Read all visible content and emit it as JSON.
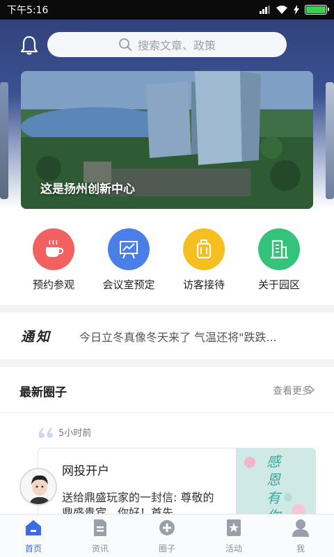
{
  "status": {
    "time": "下午5:16"
  },
  "search": {
    "placeholder": "搜索文章、政策"
  },
  "banner": {
    "caption": "这是扬州创新中心"
  },
  "quick_actions": [
    {
      "label": "预约参观",
      "icon": "coffee-cup-icon",
      "color": "#f2605f"
    },
    {
      "label": "会议室预定",
      "icon": "presentation-board-icon",
      "color": "#4a7ee8"
    },
    {
      "label": "访客接待",
      "icon": "luggage-icon",
      "color": "#f6bf1f"
    },
    {
      "label": "关于园区",
      "icon": "building-icon",
      "color": "#33c37a"
    }
  ],
  "notice": {
    "title": "通知",
    "text": "今日立冬真像冬天来了 气温还将\"跌跌..."
  },
  "circles": {
    "title": "最新圈子",
    "more": "查看更多",
    "post": {
      "time": "5小时前",
      "author": "网投开户",
      "text": "送给鼎盛玩家的一封信: 尊敬的鼎盛贵宾，你好！首先",
      "image_text": "感恩有你"
    }
  },
  "tabs": [
    {
      "label": "首页",
      "icon": "home-icon",
      "active": true
    },
    {
      "label": "资讯",
      "icon": "news-icon",
      "active": false
    },
    {
      "label": "圈子",
      "icon": "circle-plus-icon",
      "active": false
    },
    {
      "label": "活动",
      "icon": "star-badge-icon",
      "active": false
    },
    {
      "label": "我",
      "icon": "person-icon",
      "active": false
    }
  ],
  "colors": {
    "accent": "#3b6ae3",
    "battery": "#3ccf4e"
  }
}
